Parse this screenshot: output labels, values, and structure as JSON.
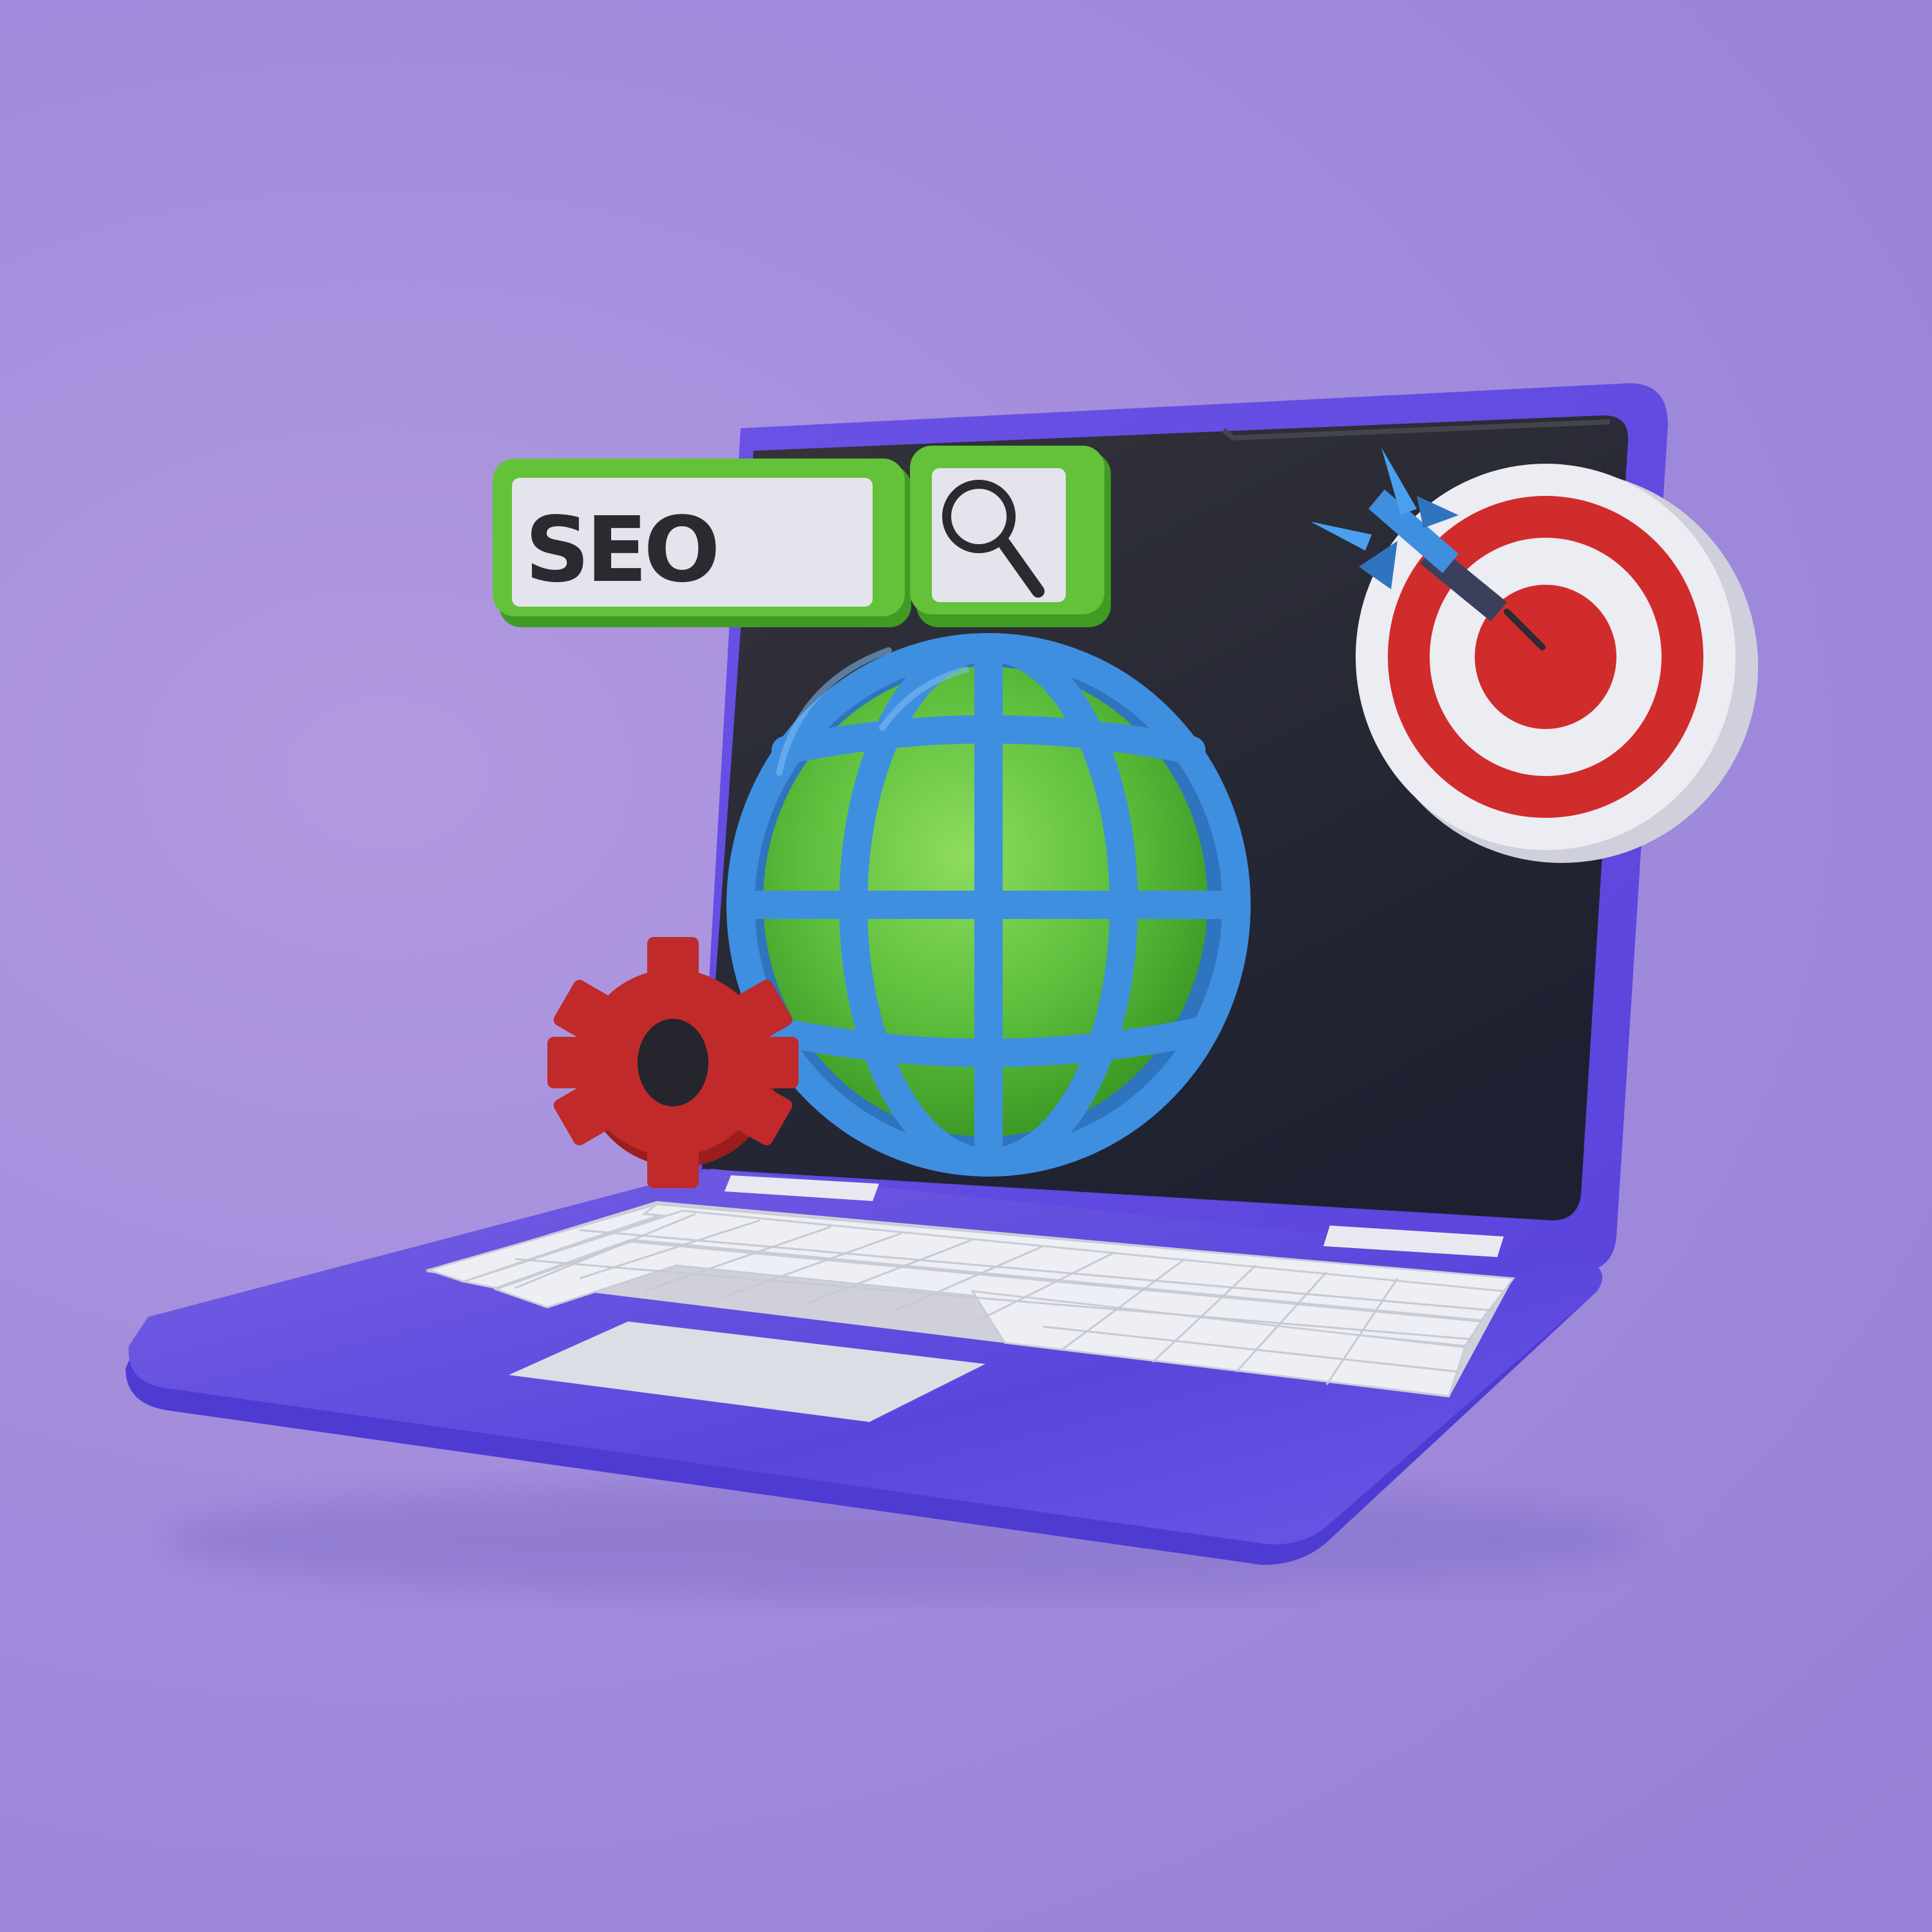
{
  "search_bar": {
    "text": "SEO"
  },
  "icons": [
    "search-icon",
    "globe-icon",
    "gear-icon",
    "target-icon",
    "dart-icon"
  ],
  "colors": {
    "background": "#a590dc",
    "laptop_body": "#5b46dc",
    "screen": "#22232b",
    "search_frame": "#63c23a",
    "search_field": "#e4e4ec",
    "globe_grid": "#3f8fe0",
    "globe_fill": "#5cbe3c",
    "gear": "#c02a2a",
    "target_red": "#d02c2c",
    "target_white": "#ececf3",
    "keys": "#eeeff4"
  }
}
